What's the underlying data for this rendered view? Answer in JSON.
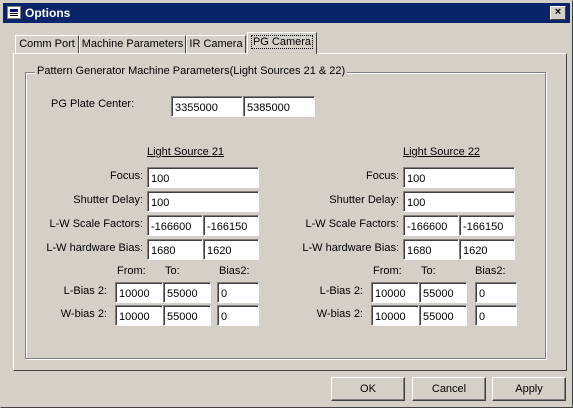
{
  "window": {
    "title": "Options",
    "close_glyph": "×"
  },
  "tabs": [
    {
      "label": "Comm Port"
    },
    {
      "label": "Machine Parameters"
    },
    {
      "label": "IR Camera"
    },
    {
      "label": "PG Camera",
      "active": true
    }
  ],
  "group": {
    "title": "Pattern Generator Machine Parameters(Light Sources 21 & 22)",
    "plate_center": {
      "label": "PG Plate Center:",
      "x": "3355000",
      "y": "5385000"
    }
  },
  "labels": {
    "focus": "Focus:",
    "shutter_delay": "Shutter Delay:",
    "lw_scale": "L-W Scale Factors:",
    "lw_bias": "L-W hardware Bias:",
    "from": "From:",
    "to": "To:",
    "bias2": "Bias2:",
    "lbias2": "L-Bias 2:",
    "wbias2": "W-bias 2:"
  },
  "ls21": {
    "title": "Light Source 21",
    "focus": "100",
    "shutter_delay": "100",
    "lw_scale": [
      "-166600",
      "-166150"
    ],
    "lw_bias": [
      "1680",
      "1620"
    ],
    "lbias2": {
      "from": "10000",
      "to": "55000",
      "bias2": "0"
    },
    "wbias2": {
      "from": "10000",
      "to": "55000",
      "bias2": "0"
    }
  },
  "ls22": {
    "title": "Light Source 22",
    "focus": "100",
    "shutter_delay": "100",
    "lw_scale": [
      "-166600",
      "-166150"
    ],
    "lw_bias": [
      "1680",
      "1620"
    ],
    "lbias2": {
      "from": "10000",
      "to": "55000",
      "bias2": "0"
    },
    "wbias2": {
      "from": "10000",
      "to": "55000",
      "bias2": "0"
    }
  },
  "buttons": {
    "ok": "OK",
    "cancel": "Cancel",
    "apply": "Apply"
  },
  "icons": {
    "title_icon": "options-window-icon",
    "close": "close-icon"
  }
}
